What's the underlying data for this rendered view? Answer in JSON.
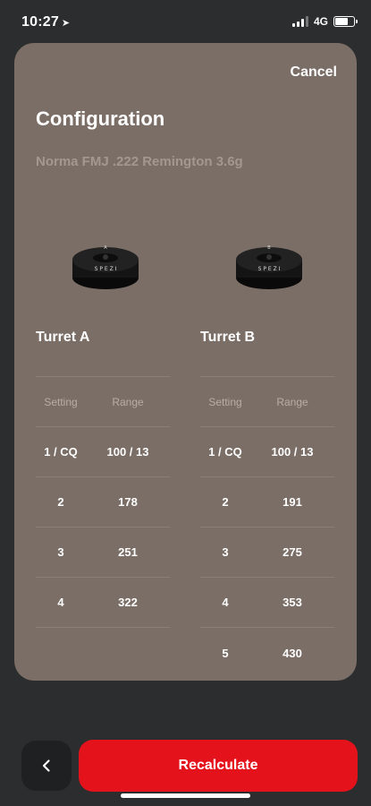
{
  "status": {
    "time": "10:27",
    "network": "4G"
  },
  "header": {
    "cancel_label": "Cancel",
    "title": "Configuration",
    "subtitle": "Norma FMJ .222 Remington 3.6g"
  },
  "turrets": [
    {
      "title": "Turret A",
      "columns": [
        "Setting",
        "Range"
      ],
      "rows": [
        {
          "setting": "1 / CQ",
          "range": "100 / 13"
        },
        {
          "setting": "2",
          "range": "178"
        },
        {
          "setting": "3",
          "range": "251"
        },
        {
          "setting": "4",
          "range": "322"
        }
      ]
    },
    {
      "title": "Turret B",
      "columns": [
        "Setting",
        "Range"
      ],
      "rows": [
        {
          "setting": "1 / CQ",
          "range": "100 / 13"
        },
        {
          "setting": "2",
          "range": "191"
        },
        {
          "setting": "3",
          "range": "275"
        },
        {
          "setting": "4",
          "range": "353"
        },
        {
          "setting": "5",
          "range": "430"
        }
      ]
    }
  ],
  "footer": {
    "recalculate_label": "Recalculate"
  },
  "colors": {
    "background": "#2b2d2e",
    "card": "#7b6e66",
    "accent": "#e3121b"
  }
}
